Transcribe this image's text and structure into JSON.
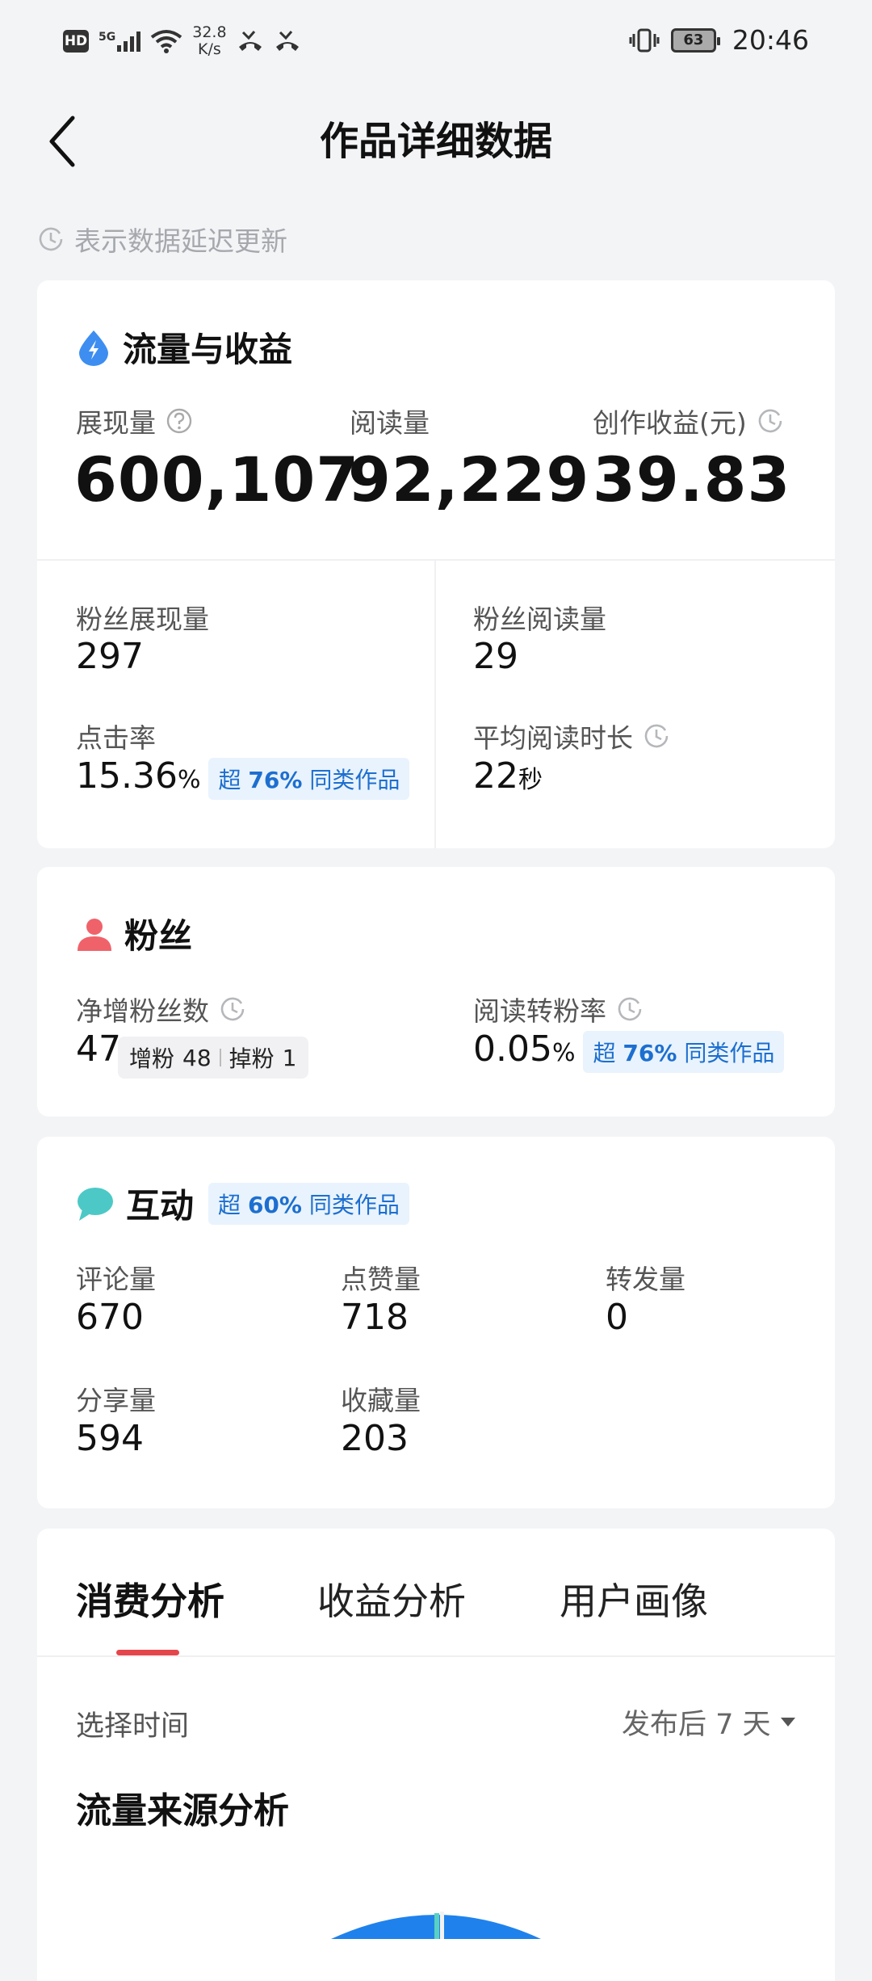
{
  "status_bar": {
    "hd": "HD",
    "network": "5G",
    "speed_value": "32.8",
    "speed_unit": "K/s",
    "battery": "63",
    "time": "20:46"
  },
  "header": {
    "title": "作品详细数据"
  },
  "delay_note": "表示数据延迟更新",
  "traffic": {
    "title": "流量与收益",
    "impressions_label": "展现量",
    "impressions": "600,107",
    "reads_label": "阅读量",
    "reads": "92,229",
    "earnings_label": "创作收益(元)",
    "earnings": "39.83",
    "fan_impr_label": "粉丝展现量",
    "fan_impr": "297",
    "fan_reads_label": "粉丝阅读量",
    "fan_reads": "29",
    "ctr_label": "点击率",
    "ctr": "15.36",
    "ctr_unit": "%",
    "ctr_badge_pre": "超",
    "ctr_badge_pct": "76%",
    "ctr_badge_post": "同类作品",
    "avg_time_label": "平均阅读时长",
    "avg_time": "22",
    "avg_time_unit": "秒"
  },
  "fans": {
    "title": "粉丝",
    "net_label": "净增粉丝数",
    "net": "47",
    "gain_label": "增粉",
    "gain": "48",
    "lose_label": "掉粉",
    "lose": "1",
    "conv_label": "阅读转粉率",
    "conv": "0.05",
    "conv_unit": "%",
    "conv_badge_pre": "超",
    "conv_badge_pct": "76%",
    "conv_badge_post": "同类作品"
  },
  "interaction": {
    "title": "互动",
    "badge_pre": "超",
    "badge_pct": "60%",
    "badge_post": "同类作品",
    "comments_label": "评论量",
    "comments": "670",
    "likes_label": "点赞量",
    "likes": "718",
    "reposts_label": "转发量",
    "reposts": "0",
    "shares_label": "分享量",
    "shares": "594",
    "favorites_label": "收藏量",
    "favorites": "203"
  },
  "analysis": {
    "tabs": [
      "消费分析",
      "收益分析",
      "用户画像"
    ],
    "active_tab": 0,
    "select_time_label": "选择时间",
    "select_time_value": "发布后 7 天",
    "source_title": "流量来源分析"
  },
  "colors": {
    "accent_blue": "#3d8ef0",
    "fans_red": "#f0626a",
    "chat_teal": "#4cc9c6",
    "tab_indicator": "#e5464b",
    "badge_text": "#1d6fcf"
  }
}
